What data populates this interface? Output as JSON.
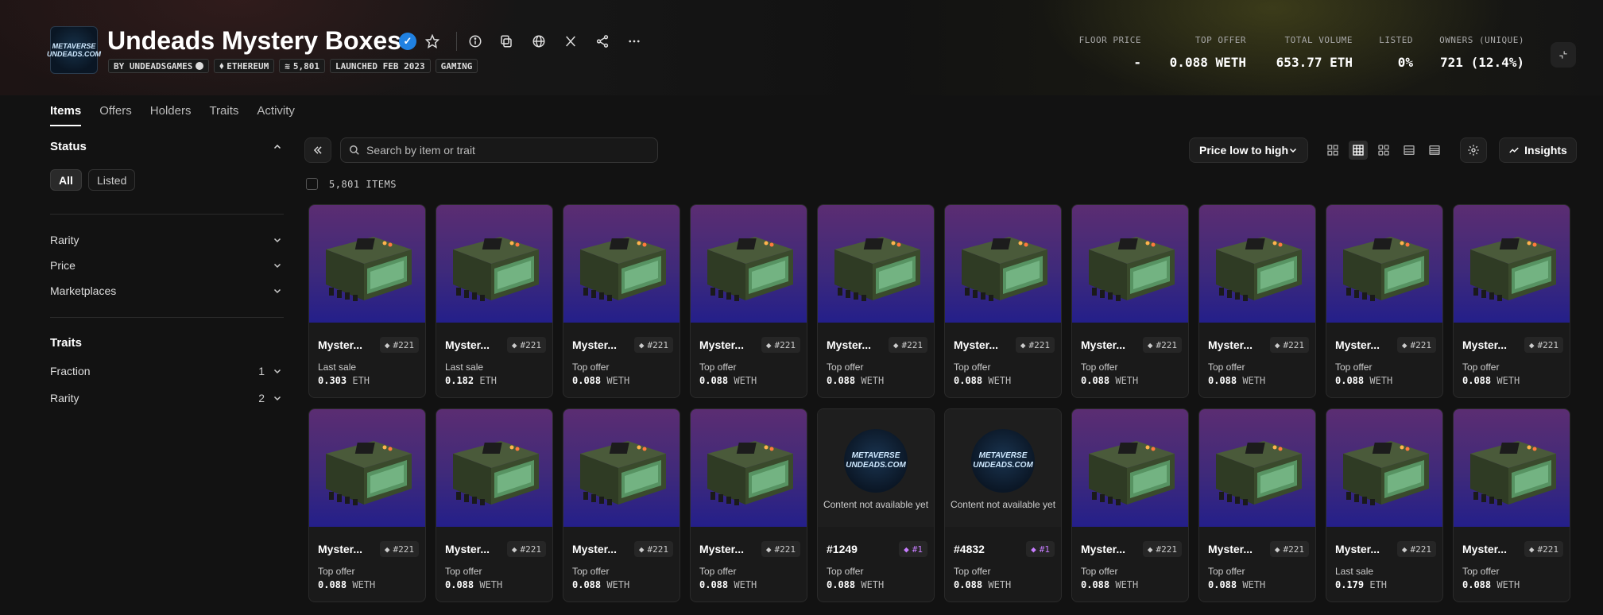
{
  "collection": {
    "title": "Undeads Mystery Boxes",
    "logo_text": "METAVERSE UNDEADS.COM",
    "tags": [
      {
        "label": "BY UNDEADSGAMES",
        "icon": "verified-small-icon"
      },
      {
        "label": "ETHEREUM",
        "icon": "ethereum-icon"
      },
      {
        "label": "5,801",
        "icon": "layers-icon"
      },
      {
        "label": "LAUNCHED FEB 2023",
        "icon": ""
      },
      {
        "label": "GAMING",
        "icon": ""
      }
    ]
  },
  "stats": [
    {
      "label": "FLOOR PRICE",
      "value": "-"
    },
    {
      "label": "TOP OFFER",
      "value": "0.088 WETH"
    },
    {
      "label": "TOTAL VOLUME",
      "value": "653.77 ETH"
    },
    {
      "label": "LISTED",
      "value": "0%"
    },
    {
      "label": "OWNERS (UNIQUE)",
      "value": "721 (12.4%)"
    }
  ],
  "tabs": [
    "Items",
    "Offers",
    "Holders",
    "Traits",
    "Activity"
  ],
  "sidebar": {
    "status_heading": "Status",
    "status_pills": [
      "All",
      "Listed"
    ],
    "filters": [
      "Rarity",
      "Price",
      "Marketplaces"
    ],
    "traits_heading": "Traits",
    "traits": [
      {
        "label": "Fraction",
        "count": "1"
      },
      {
        "label": "Rarity",
        "count": "2"
      }
    ]
  },
  "toolbar": {
    "search_placeholder": "Search by item or trait",
    "sort_label": "Price low to high",
    "insights_label": "Insights",
    "item_count": "5,801 ITEMS"
  },
  "items": [
    {
      "name": "Myster...",
      "rank": "#221",
      "label": "Last sale",
      "price": "0.303",
      "currency": "ETH",
      "type": "box"
    },
    {
      "name": "Myster...",
      "rank": "#221",
      "label": "Last sale",
      "price": "0.182",
      "currency": "ETH",
      "type": "box"
    },
    {
      "name": "Myster...",
      "rank": "#221",
      "label": "Top offer",
      "price": "0.088",
      "currency": "WETH",
      "type": "box"
    },
    {
      "name": "Myster...",
      "rank": "#221",
      "label": "Top offer",
      "price": "0.088",
      "currency": "WETH",
      "type": "box"
    },
    {
      "name": "Myster...",
      "rank": "#221",
      "label": "Top offer",
      "price": "0.088",
      "currency": "WETH",
      "type": "box"
    },
    {
      "name": "Myster...",
      "rank": "#221",
      "label": "Top offer",
      "price": "0.088",
      "currency": "WETH",
      "type": "box"
    },
    {
      "name": "Myster...",
      "rank": "#221",
      "label": "Top offer",
      "price": "0.088",
      "currency": "WETH",
      "type": "box"
    },
    {
      "name": "Myster...",
      "rank": "#221",
      "label": "Top offer",
      "price": "0.088",
      "currency": "WETH",
      "type": "box"
    },
    {
      "name": "Myster...",
      "rank": "#221",
      "label": "Top offer",
      "price": "0.088",
      "currency": "WETH",
      "type": "box"
    },
    {
      "name": "Myster...",
      "rank": "#221",
      "label": "Top offer",
      "price": "0.088",
      "currency": "WETH",
      "type": "box"
    },
    {
      "name": "Myster...",
      "rank": "#221",
      "label": "Top offer",
      "price": "0.088",
      "currency": "WETH",
      "type": "box"
    },
    {
      "name": "Myster...",
      "rank": "#221",
      "label": "Top offer",
      "price": "0.088",
      "currency": "WETH",
      "type": "box"
    },
    {
      "name": "Myster...",
      "rank": "#221",
      "label": "Top offer",
      "price": "0.088",
      "currency": "WETH",
      "type": "box"
    },
    {
      "name": "Myster...",
      "rank": "#221",
      "label": "Top offer",
      "price": "0.088",
      "currency": "WETH",
      "type": "box"
    },
    {
      "name": "#1249",
      "rank": "#1",
      "label": "Top offer",
      "price": "0.088",
      "currency": "WETH",
      "type": "na",
      "na_text": "Content not available yet"
    },
    {
      "name": "#4832",
      "rank": "#1",
      "label": "Top offer",
      "price": "0.088",
      "currency": "WETH",
      "type": "na",
      "na_text": "Content not available yet"
    },
    {
      "name": "Myster...",
      "rank": "#221",
      "label": "Top offer",
      "price": "0.088",
      "currency": "WETH",
      "type": "box"
    },
    {
      "name": "Myster...",
      "rank": "#221",
      "label": "Top offer",
      "price": "0.088",
      "currency": "WETH",
      "type": "box"
    },
    {
      "name": "Myster...",
      "rank": "#221",
      "label": "Last sale",
      "price": "0.179",
      "currency": "ETH",
      "type": "box"
    },
    {
      "name": "Myster...",
      "rank": "#221",
      "label": "Top offer",
      "price": "0.088",
      "currency": "WETH",
      "type": "box"
    }
  ],
  "colors": {
    "accent": "#2081e2",
    "card_top": "#5b2d72",
    "card_bottom": "#241f8a",
    "rank_highlight": "#c77dff"
  }
}
